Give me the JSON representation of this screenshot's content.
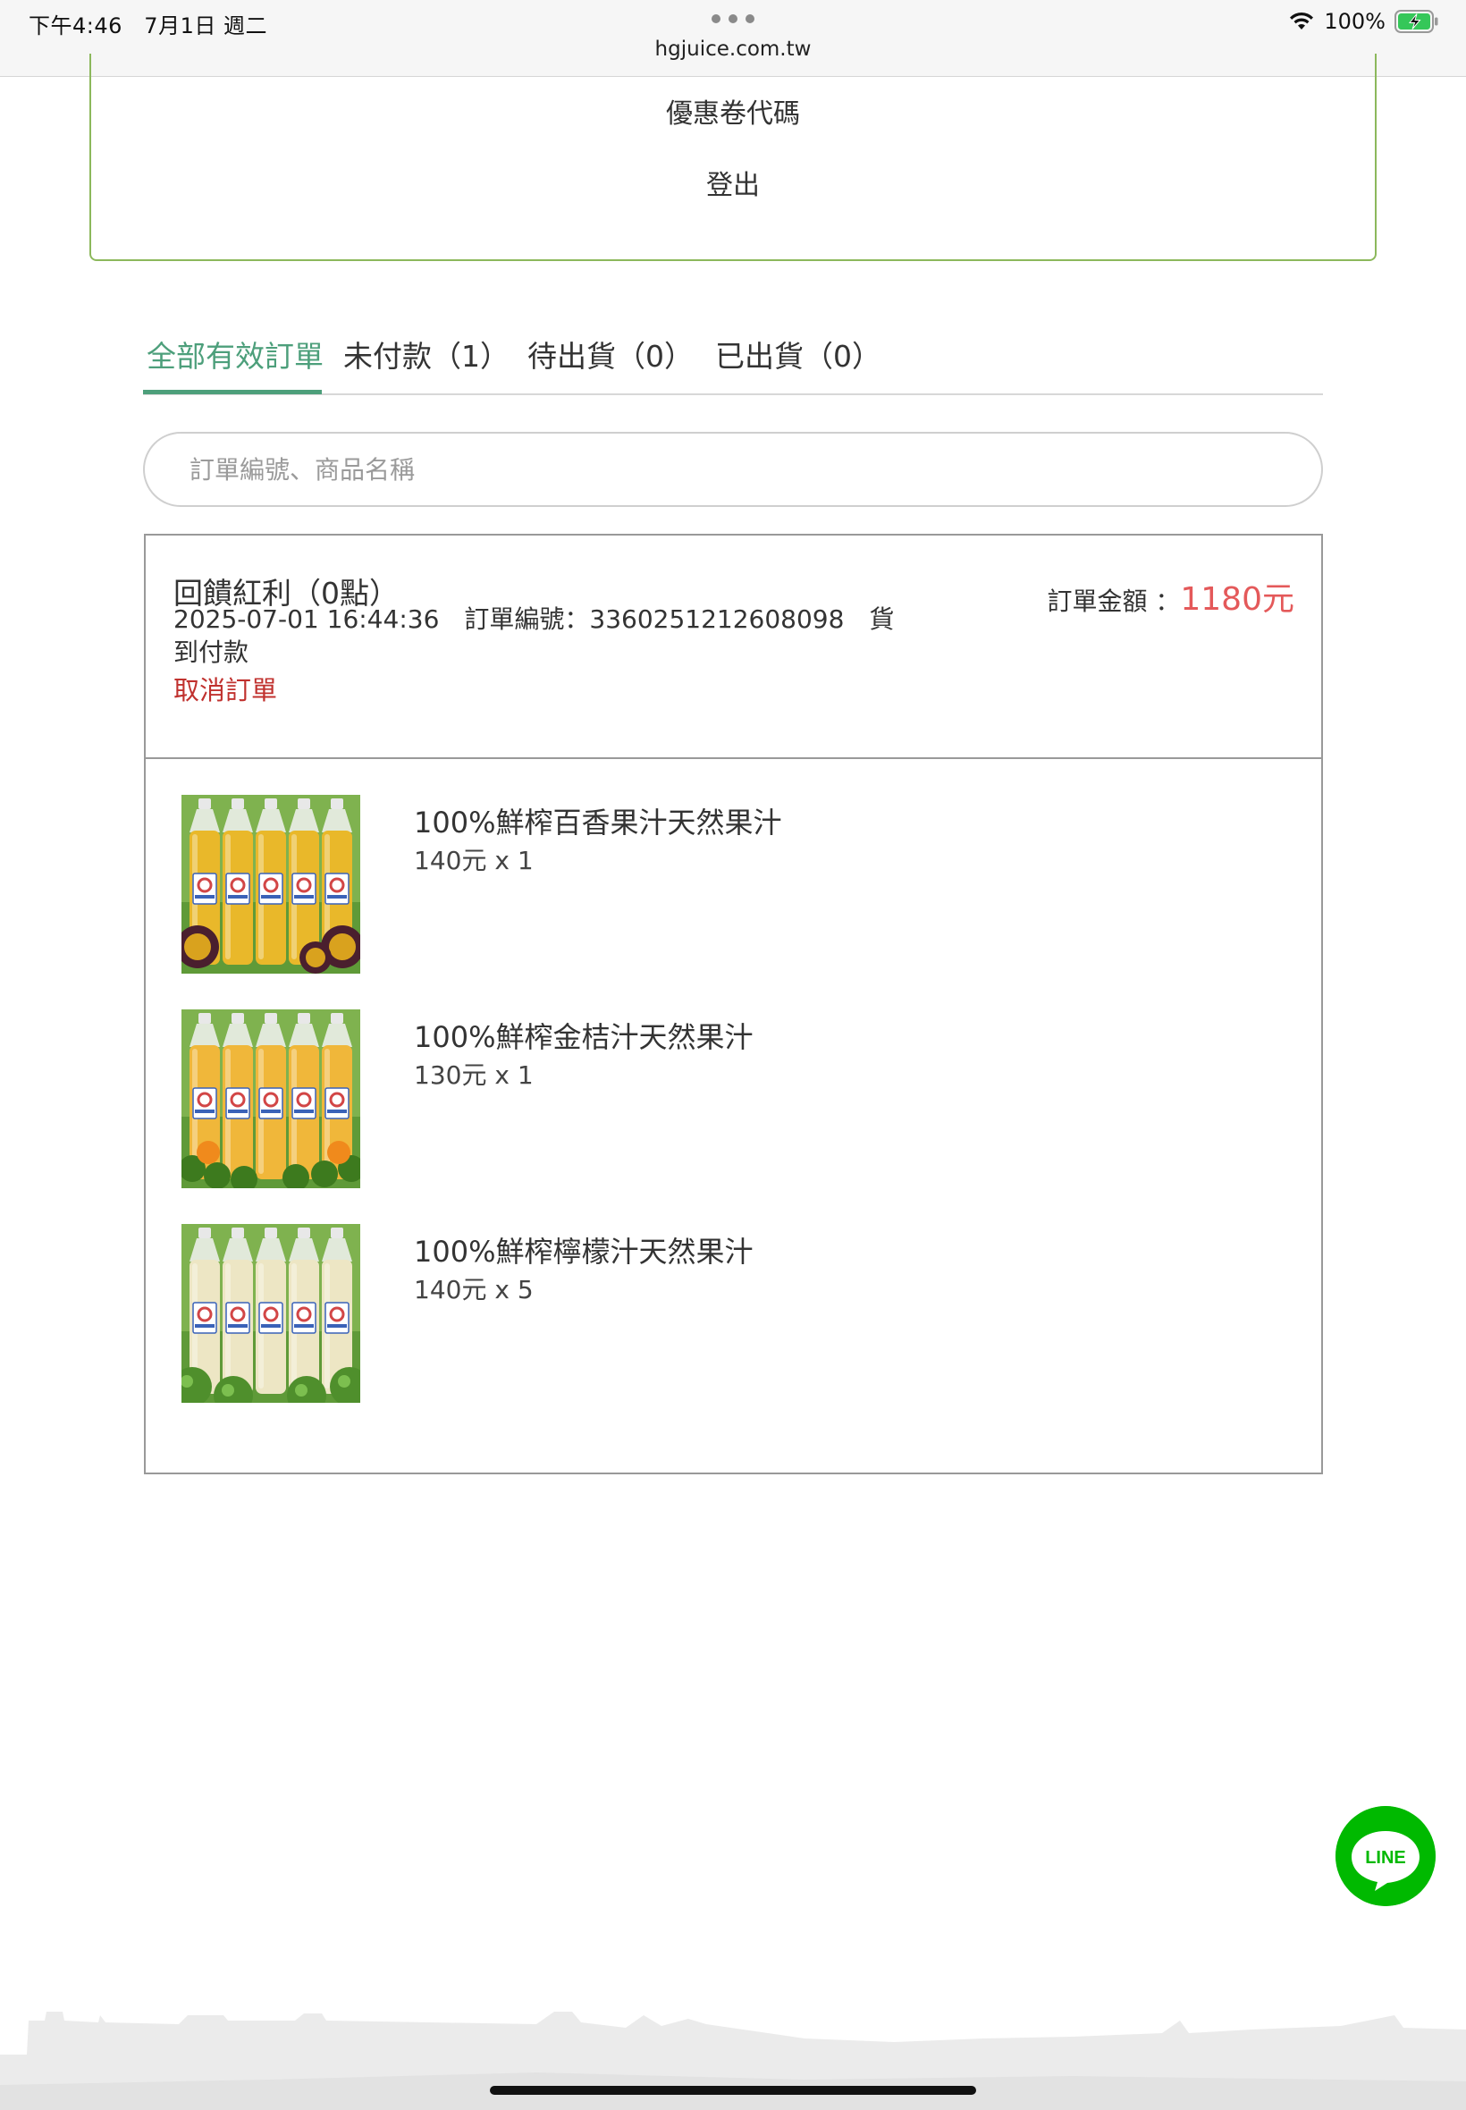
{
  "status_bar": {
    "time": "下午4:46",
    "date": "7月1日 週二",
    "url": "hgjuice.com.tw",
    "battery": "100%"
  },
  "menu": {
    "coupon_code": "優惠卷代碼",
    "logout": "登出"
  },
  "tabs": [
    {
      "label": "全部有效訂單",
      "active": true
    },
    {
      "label": "未付款（1）",
      "active": false
    },
    {
      "label": "待出貨（0）",
      "active": false
    },
    {
      "label": "已出貨（0）",
      "active": false
    }
  ],
  "search": {
    "placeholder": "訂單編號、商品名稱"
  },
  "order": {
    "title": "回饋紅利（0點）",
    "meta": "2025-07-01 16:44:36　訂單編號：3360251212608098　貨到付款",
    "cancel": "取消訂單",
    "amount_label": "訂單金額 ：",
    "amount_value": "1180元",
    "items": [
      {
        "name": "100%鮮榨百香果汁天然果汁",
        "price": "140元 x 1",
        "juice_color": "#e9b82a",
        "fruit": "passion-fruit"
      },
      {
        "name": "100%鮮榨金桔汁天然果汁",
        "price": "130元 x 1",
        "juice_color": "#f0b73a",
        "fruit": "kumquat"
      },
      {
        "name": "100%鮮榨檸檬汁天然果汁",
        "price": "140元 x 5",
        "juice_color": "#ede6c4",
        "fruit": "lemon"
      }
    ]
  },
  "line_button": {
    "label": "LINE"
  },
  "colors": {
    "accent_green": "#4d9f7b",
    "menu_border": "#8cb85c",
    "price_red": "#e4595a",
    "cancel_red": "#c0312e",
    "line_green": "#00b900"
  }
}
